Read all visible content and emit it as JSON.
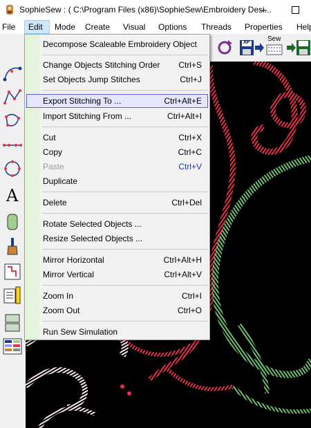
{
  "window": {
    "title": "SophieSew : ( C:\\Program Files (x86)\\SophieSew\\Embroidery Desi..."
  },
  "menubar": [
    "File",
    "Edit",
    "Mode",
    "Create",
    "Visual",
    "Options",
    "Threads",
    "Properties",
    "Help"
  ],
  "edit_menu": {
    "items": [
      {
        "label": "Decompose Scaleable Embroidery Object",
        "shortcut": ""
      },
      {
        "label": "Change Objects Stitching Order",
        "shortcut": "Ctrl+S"
      },
      {
        "label": "Set Objects Jump Stitches",
        "shortcut": "Ctrl+J"
      },
      {
        "label": "Export Stitching To ...",
        "shortcut": "Ctrl+Alt+E"
      },
      {
        "label": "Import Stitching From ...",
        "shortcut": "Ctrl+Alt+I"
      },
      {
        "label": "Cut",
        "shortcut": "Ctrl+X"
      },
      {
        "label": "Copy",
        "shortcut": "Ctrl+C"
      },
      {
        "label": "Paste",
        "shortcut": "Ctrl+V"
      },
      {
        "label": "Duplicate",
        "shortcut": ""
      },
      {
        "label": "Delete",
        "shortcut": "Ctrl+Del"
      },
      {
        "label": "Rotate Selected Objects ...",
        "shortcut": ""
      },
      {
        "label": "Resize Selected Objects ...",
        "shortcut": ""
      },
      {
        "label": "Mirror Horizontal",
        "shortcut": "Ctrl+Alt+H"
      },
      {
        "label": "Mirror Vertical",
        "shortcut": "Ctrl+Alt+V"
      },
      {
        "label": "Zoom In",
        "shortcut": "Ctrl+I"
      },
      {
        "label": "Zoom Out",
        "shortcut": "Ctrl+O"
      },
      {
        "label": "Run Sew Simulation",
        "shortcut": ""
      }
    ]
  },
  "toolbar": {
    "sew_label": "Sew",
    "xp_label": "XP"
  },
  "left_tools": {
    "text_tool_glyph": "A"
  },
  "colors": {
    "accent_red": "#e8304a",
    "accent_green": "#6fbf73",
    "gutter": "#e3f3dc",
    "highlight": "#e5e5ff"
  }
}
